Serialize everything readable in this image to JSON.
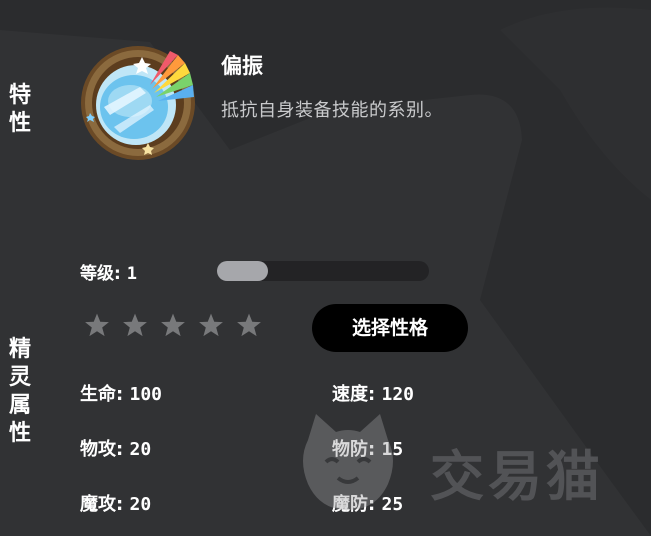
{
  "side_labels": {
    "trait": [
      "特",
      "性"
    ],
    "attributes": [
      "精",
      "灵",
      "属",
      "性"
    ]
  },
  "trait": {
    "icon": "rainbow-mirror-icon",
    "name": "偏振",
    "description": "抵抗自身装备技能的系别。"
  },
  "level": {
    "label": "等级:",
    "value": "1",
    "progress": 0.24
  },
  "stars": {
    "total": 5,
    "filled": 0,
    "icon": "star-icon"
  },
  "nature_button": {
    "label": "选择性格"
  },
  "stats": {
    "hp": {
      "label": "生命:",
      "value": "100"
    },
    "speed": {
      "label": "速度:",
      "value": "120"
    },
    "phys_atk": {
      "label": "物攻:",
      "value": "20"
    },
    "phys_def": {
      "label": "物防:",
      "value": "15"
    },
    "mag_atk": {
      "label": "魔攻:",
      "value": "20"
    },
    "mag_def": {
      "label": "魔防:",
      "value": "25"
    }
  },
  "watermark": {
    "text": "交易猫",
    "icon": "cat-logo-icon"
  },
  "colors": {
    "background": "#2b2c2e",
    "panel_shape": "#323335",
    "button": "#000000",
    "bar_fill": "#a6a7ab",
    "bar_track": "#232325",
    "star": "#78797b"
  }
}
